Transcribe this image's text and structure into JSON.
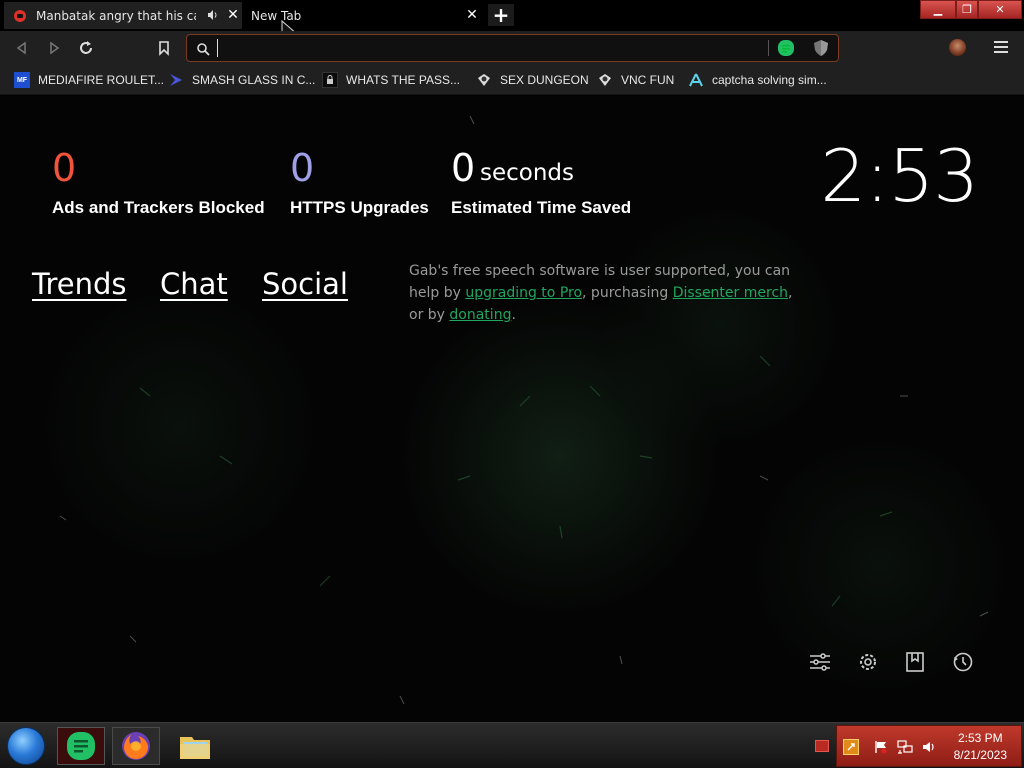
{
  "tabs": [
    {
      "title": "Manbatak angry that his cage",
      "active": true
    },
    {
      "title": "New Tab",
      "active": false
    }
  ],
  "window_controls": [
    "minimize",
    "restore",
    "close"
  ],
  "toolbar": {
    "back_icon": "back-arrow-icon",
    "forward_icon": "forward-arrow-icon",
    "reload_icon": "reload-icon",
    "bookmark_icon": "bookmark-icon",
    "url_value": "",
    "url_placeholder": ""
  },
  "bookmarks": [
    {
      "label": "MEDIAFIRE ROULET...",
      "icon": "mediafire-icon"
    },
    {
      "label": "SMASH GLASS IN C...",
      "icon": "smash-glass-icon"
    },
    {
      "label": "WHATS THE PASS...",
      "icon": "lock-icon"
    },
    {
      "label": "SEX DUNGEON",
      "icon": "vnc-eye-icon"
    },
    {
      "label": "VNC FUN",
      "icon": "vnc-eye-icon"
    },
    {
      "label": "captcha solving sim...",
      "icon": "captcha-icon"
    }
  ],
  "stats": {
    "ads_blocked": {
      "value": "0",
      "label": "Ads and Trackers Blocked",
      "color": "#f2533c"
    },
    "https_upgrades": {
      "value": "0",
      "label": "HTTPS Upgrades",
      "color": "#a0a0e8"
    },
    "time_saved": {
      "value": "0",
      "unit": "seconds",
      "label": "Estimated Time Saved",
      "color": "#ffffff"
    }
  },
  "clock": "2:53",
  "nav_links": [
    "Trends",
    "Chat",
    "Social"
  ],
  "support": {
    "part1": "Gab's free speech software is user supported, you can help by ",
    "link1": "upgrading to Pro",
    "part2": ", purchasing ",
    "link2": "Dissenter merch",
    "part3": ", or by ",
    "link3": "donating",
    "part4": "."
  },
  "bottom_icons": [
    "sliders-icon",
    "gear-icon",
    "bookmarks-icon",
    "history-icon"
  ],
  "taskbar": {
    "items": [
      "start-orb-icon",
      "dissenter-app-icon",
      "firefox-icon",
      "file-explorer-icon"
    ],
    "time": "2:53 PM",
    "date": "8/21/2023"
  },
  "colors": {
    "accent_red": "#c0392b",
    "link_green": "#21a660",
    "url_border": "#7b3a22"
  }
}
